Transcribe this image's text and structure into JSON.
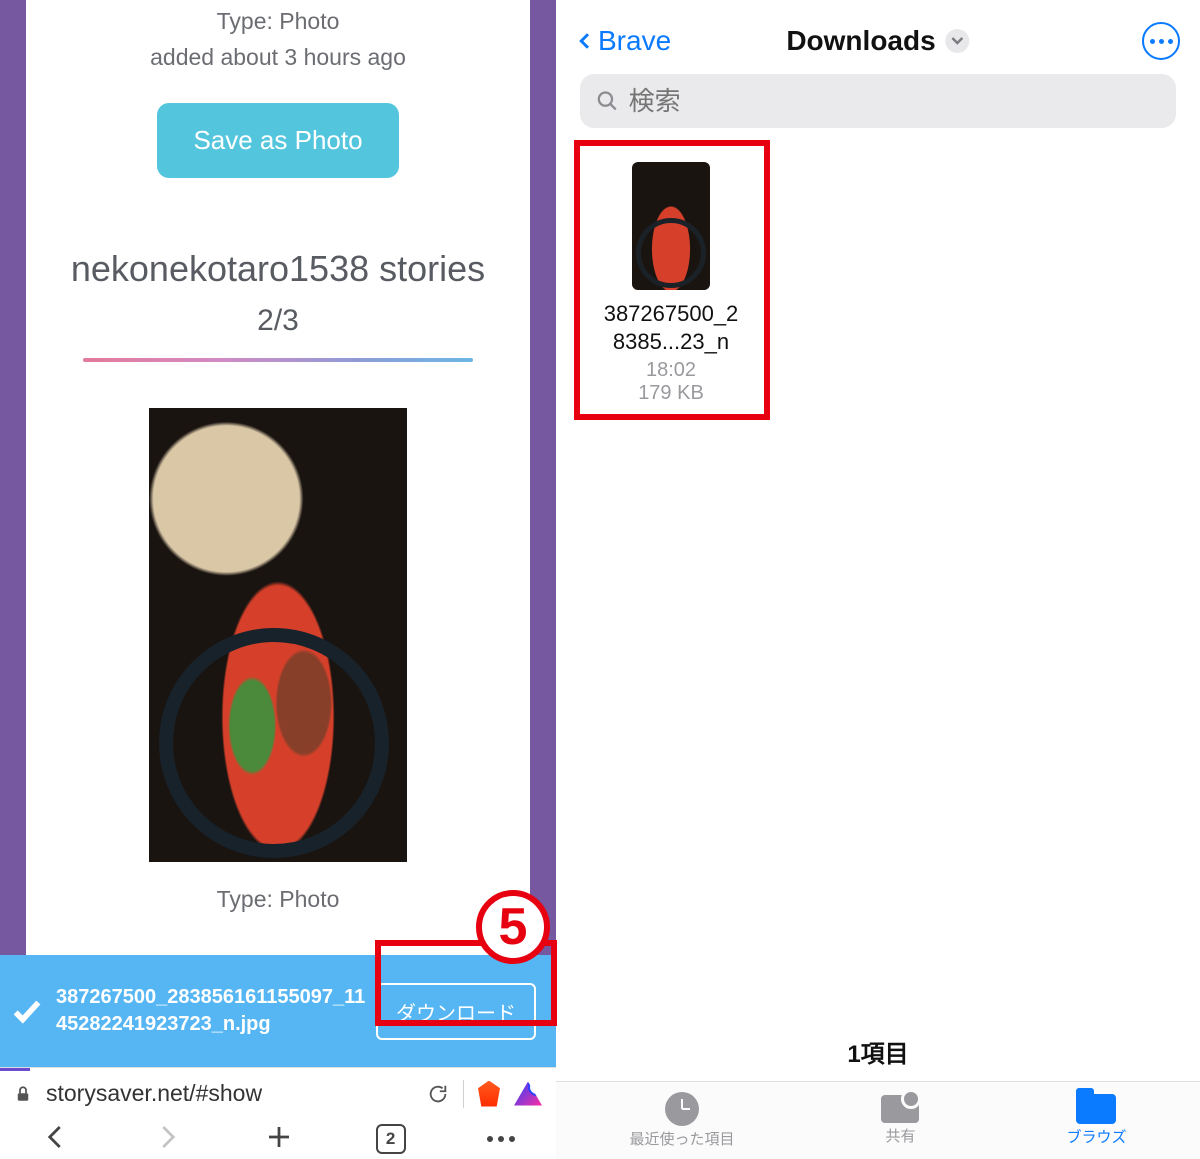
{
  "left": {
    "type_label": "Type: Photo",
    "added_label": "added about 3 hours ago",
    "save_btn": "Save as Photo",
    "stories_title": "nekonekotaro1538 stories",
    "stories_count": "2/3",
    "type_label2": "Type: Photo",
    "filename": "387267500_283856161155097_1145282241923723_n.jpg",
    "download_btn": "ダウンロード",
    "url": "storysaver.net/#show",
    "tab_count": "2",
    "annot_number": "5"
  },
  "right": {
    "back_label": "Brave",
    "title": "Downloads",
    "search_placeholder": "検索",
    "file": {
      "name_line1": "387267500_2",
      "name_line2": "8385...23_n",
      "time": "18:02",
      "size": "179 KB"
    },
    "item_count": "1項目",
    "tabs": {
      "recent": "最近使った項目",
      "share": "共有",
      "browse": "ブラウズ"
    }
  }
}
